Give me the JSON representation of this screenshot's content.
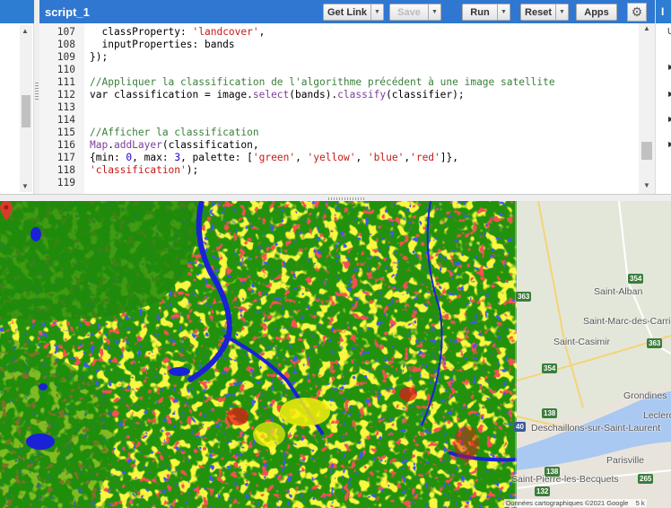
{
  "editor": {
    "tab_title": "script_1",
    "buttons": {
      "get_link": "Get Link",
      "save": "Save",
      "run": "Run",
      "reset": "Reset",
      "apps": "Apps"
    },
    "lines": [
      {
        "n": "107",
        "html": "  classProperty: <span class='tok-str'>'landcover'</span>,"
      },
      {
        "n": "108",
        "html": "  inputProperties: bands"
      },
      {
        "n": "109",
        "html": "});"
      },
      {
        "n": "110",
        "html": ""
      },
      {
        "n": "111",
        "html": "<span class='tok-com'>//Appliquer la classification de l'algorithme précédent à une image satellite</span>"
      },
      {
        "n": "112",
        "html": "var classification = image.<span class='tok-fn'>select</span>(bands).<span class='tok-fn'>classify</span>(classifier);"
      },
      {
        "n": "113",
        "html": ""
      },
      {
        "n": "114",
        "html": ""
      },
      {
        "n": "115",
        "html": "<span class='tok-com'>//Afficher la classification</span>"
      },
      {
        "n": "116",
        "html": "<span class='tok-fn'>Map</span>.<span class='tok-fn'>addLayer</span>(classification,"
      },
      {
        "n": "117",
        "html": "{min: <span class='tok-num'>0</span>, max: <span class='tok-num'>3</span>, palette: [<span class='tok-str'>'green'</span>, <span class='tok-str'>'yellow'</span>, <span class='tok-str'>'blue'</span>,<span class='tok-str'>'red'</span>]},"
      },
      {
        "n": "118",
        "html": "<span class='tok-str'>'classification'</span>);"
      },
      {
        "n": "119",
        "html": ""
      }
    ]
  },
  "right_panel": {
    "tab_text": "I",
    "first_letter": "U"
  },
  "map": {
    "places": [
      {
        "text": "Saint-Alban"
      },
      {
        "text": "Saint-Marc-des-Carrières"
      },
      {
        "text": "Saint-Casimir"
      },
      {
        "text": "Grondines"
      },
      {
        "text": "Leclercville"
      },
      {
        "text": "Deschaillons-sur-Saint-Laurent"
      },
      {
        "text": "Parisville"
      },
      {
        "text": "Saint-Pierre-les-Becquets"
      }
    ],
    "shields": [
      {
        "text": "354"
      },
      {
        "text": "363"
      },
      {
        "text": "363"
      },
      {
        "text": "354"
      },
      {
        "text": "138"
      },
      {
        "text": "40"
      },
      {
        "text": "138"
      },
      {
        "text": "265"
      },
      {
        "text": "132"
      }
    ],
    "attribution": "Données cartographiques ©2021 Google",
    "scale": "5 k",
    "classification_palette": [
      "green",
      "yellow",
      "blue",
      "red"
    ]
  }
}
